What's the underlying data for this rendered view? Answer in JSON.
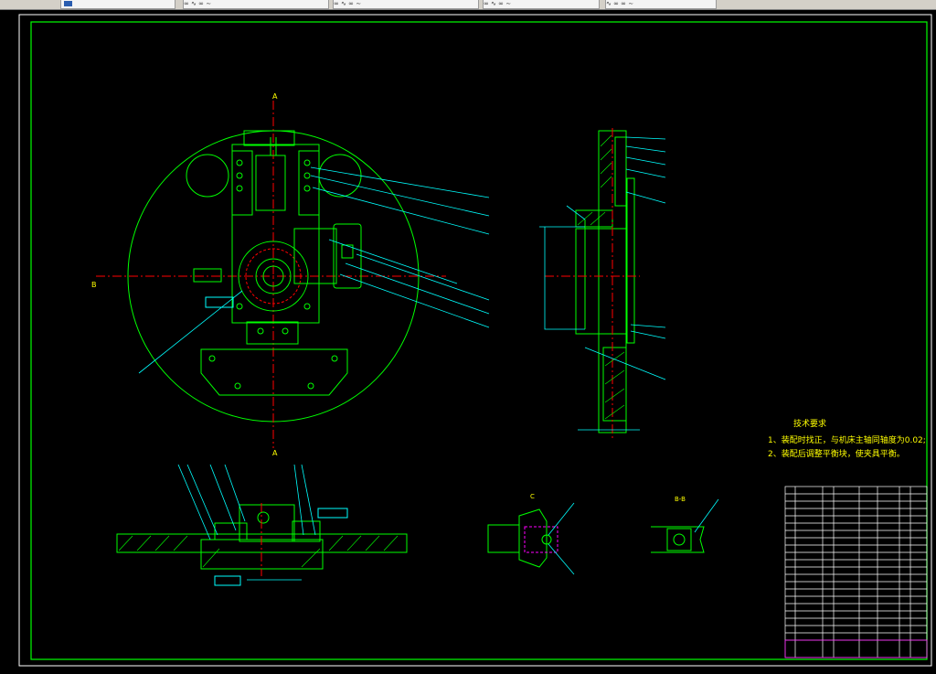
{
  "tabs": [
    {
      "label": ""
    },
    {
      "label": "∞ ∿ ∞ ∼"
    },
    {
      "label": "∞ ∿ ∞ ∼"
    },
    {
      "label": "∞ ∿ ∞ ∼"
    },
    {
      "label": "∿ ∞ ∞ ∼"
    }
  ],
  "drawing": {
    "tech_title": "技术要求",
    "tech_line1": "1、装配时找正，与机床主轴同轴度为0.02;",
    "tech_line2": "2、装配后调整平衡块，使夹具平衡。",
    "section_label_top": "A",
    "section_label_bottom": "A",
    "view_label_left": "B",
    "view_label_b": "B-B",
    "view_label_detail": "C"
  },
  "colors": {
    "frame": "#00ff00",
    "part": "#00ff00",
    "hatch": "#00ff00",
    "leader": "#00ffff",
    "center": "#ff0000",
    "text": "#ffff00",
    "title_block": "#ffffff",
    "title_accent": "#ff00ff"
  }
}
